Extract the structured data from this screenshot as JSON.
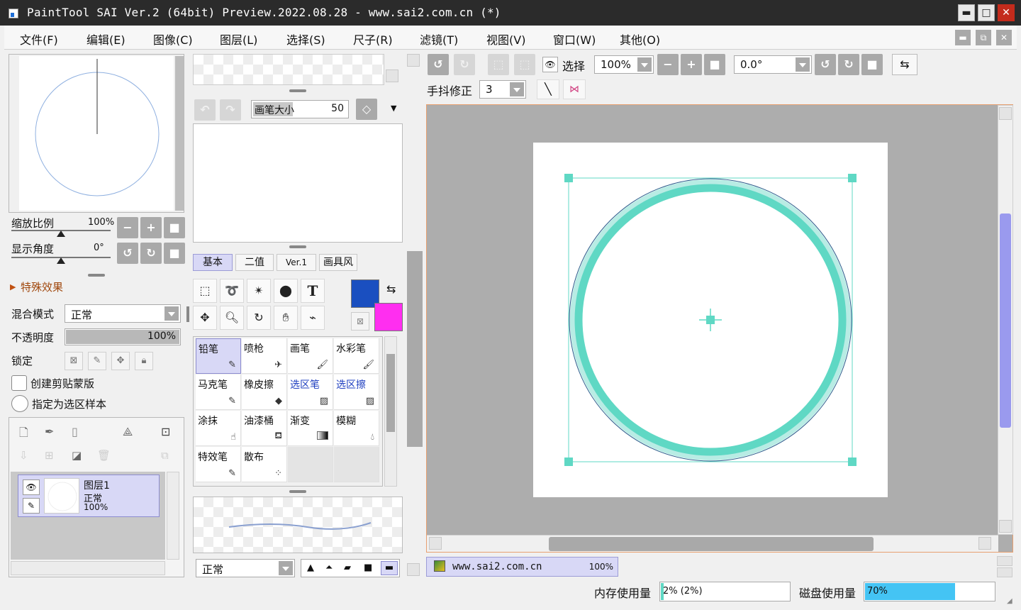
{
  "window": {
    "title": "PaintTool SAI Ver.2 (64bit) Preview.2022.08.28 - www.sai2.com.cn (*)",
    "min_label": "▬",
    "max_label": "□",
    "close_label": "✕"
  },
  "menu": {
    "items": [
      "文件(F)",
      "编辑(E)",
      "图像(C)",
      "图层(L)",
      "选择(S)",
      "尺子(R)",
      "滤镜(T)",
      "视图(V)",
      "窗口(W)",
      "其他(O)"
    ],
    "mdi_min": "▬",
    "mdi_restore": "⧉",
    "mdi_close": "✕"
  },
  "navigator": {
    "zoom_label": "缩放比例",
    "zoom_value": "100%",
    "zoom_level": 0.5,
    "angle_label": "显示角度",
    "angle_value": "0°",
    "angle_level": 0.5
  },
  "effects": {
    "label": "特殊效果"
  },
  "layer_props": {
    "blend_label": "混合模式",
    "blend_value": "正常",
    "opacity_label": "不透明度",
    "opacity_value": "100%",
    "opacity_level": 1.0,
    "lock_label": "锁定",
    "clip_label": "创建剪贴蒙版",
    "selection_source_label": "指定为选区样本"
  },
  "layers": [
    {
      "name": "图层1",
      "mode": "正常",
      "opacity": "100%"
    }
  ],
  "brush_size": {
    "label": "画笔大小",
    "value": "50"
  },
  "tool_tabs": [
    "基本",
    "二值",
    "Ver.1",
    "画具风"
  ],
  "colors": {
    "primary": "#1a4fc0",
    "secondary": "#ff2ef0",
    "accent_teal": "#5fd8c4",
    "scrollbar_thumb": "#9a9aee",
    "disk_bar": "#44c4f4"
  },
  "brushes": [
    {
      "name": "铅笔",
      "icon": "pencil-icon",
      "selected": true,
      "blue": false
    },
    {
      "name": "喷枪",
      "icon": "airbrush-icon",
      "selected": false,
      "blue": false
    },
    {
      "name": "画笔",
      "icon": "brush-icon",
      "selected": false,
      "blue": false
    },
    {
      "name": "水彩笔",
      "icon": "watercolor-icon",
      "selected": false,
      "blue": false
    },
    {
      "name": "马克笔",
      "icon": "marker-icon",
      "selected": false,
      "blue": false
    },
    {
      "name": "橡皮擦",
      "icon": "eraser-icon",
      "selected": false,
      "blue": false
    },
    {
      "name": "选区笔",
      "icon": "selection-pen-icon",
      "selected": false,
      "blue": true
    },
    {
      "name": "选区擦",
      "icon": "selection-eraser-icon",
      "selected": false,
      "blue": true
    },
    {
      "name": "涂抹",
      "icon": "smudge-icon",
      "selected": false,
      "blue": false
    },
    {
      "name": "油漆桶",
      "icon": "bucket-icon",
      "selected": false,
      "blue": false
    },
    {
      "name": "渐变",
      "icon": "gradient-icon",
      "selected": false,
      "blue": false
    },
    {
      "name": "模糊",
      "icon": "blur-icon",
      "selected": false,
      "blue": false
    },
    {
      "name": "特效笔",
      "icon": "effect-pen-icon",
      "selected": false,
      "blue": false
    },
    {
      "name": "散布",
      "icon": "scatter-icon",
      "selected": false,
      "blue": false
    }
  ],
  "brush_mode": {
    "value": "正常"
  },
  "canvas_toolbar": {
    "selection_label": "选择",
    "zoom_value": "100%",
    "rotation_value": "0.0°",
    "stabilizer_label": "手抖修正",
    "stabilizer_value": "3"
  },
  "document_tab": {
    "name": "www.sai2.com.cn",
    "zoom": "100%"
  },
  "status": {
    "memory_label": "内存使用量",
    "memory_value": "2% (2%)",
    "memory_level": 0.02,
    "disk_label": "磁盘使用量",
    "disk_value": "70%",
    "disk_level": 0.7
  }
}
